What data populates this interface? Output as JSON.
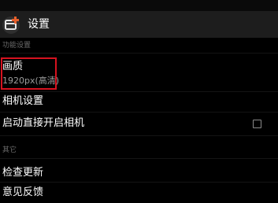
{
  "app": {
    "title": "设置",
    "icon": "camera-settings-app-icon",
    "icon_accent": "#e8602c"
  },
  "sections": [
    {
      "header": "功能设置",
      "items": [
        {
          "title": "画质",
          "subtitle": "1920px(高清)",
          "highlighted": true
        },
        {
          "title": "相机设置"
        },
        {
          "title": "启动直接开启相机",
          "checkbox": false
        }
      ]
    },
    {
      "header": "其它",
      "items": [
        {
          "title": "检查更新"
        },
        {
          "title": "意见反馈"
        }
      ]
    }
  ],
  "colors": {
    "background": "#000000",
    "titlebar": "#1d1d1d",
    "highlight": "#d6121f"
  }
}
